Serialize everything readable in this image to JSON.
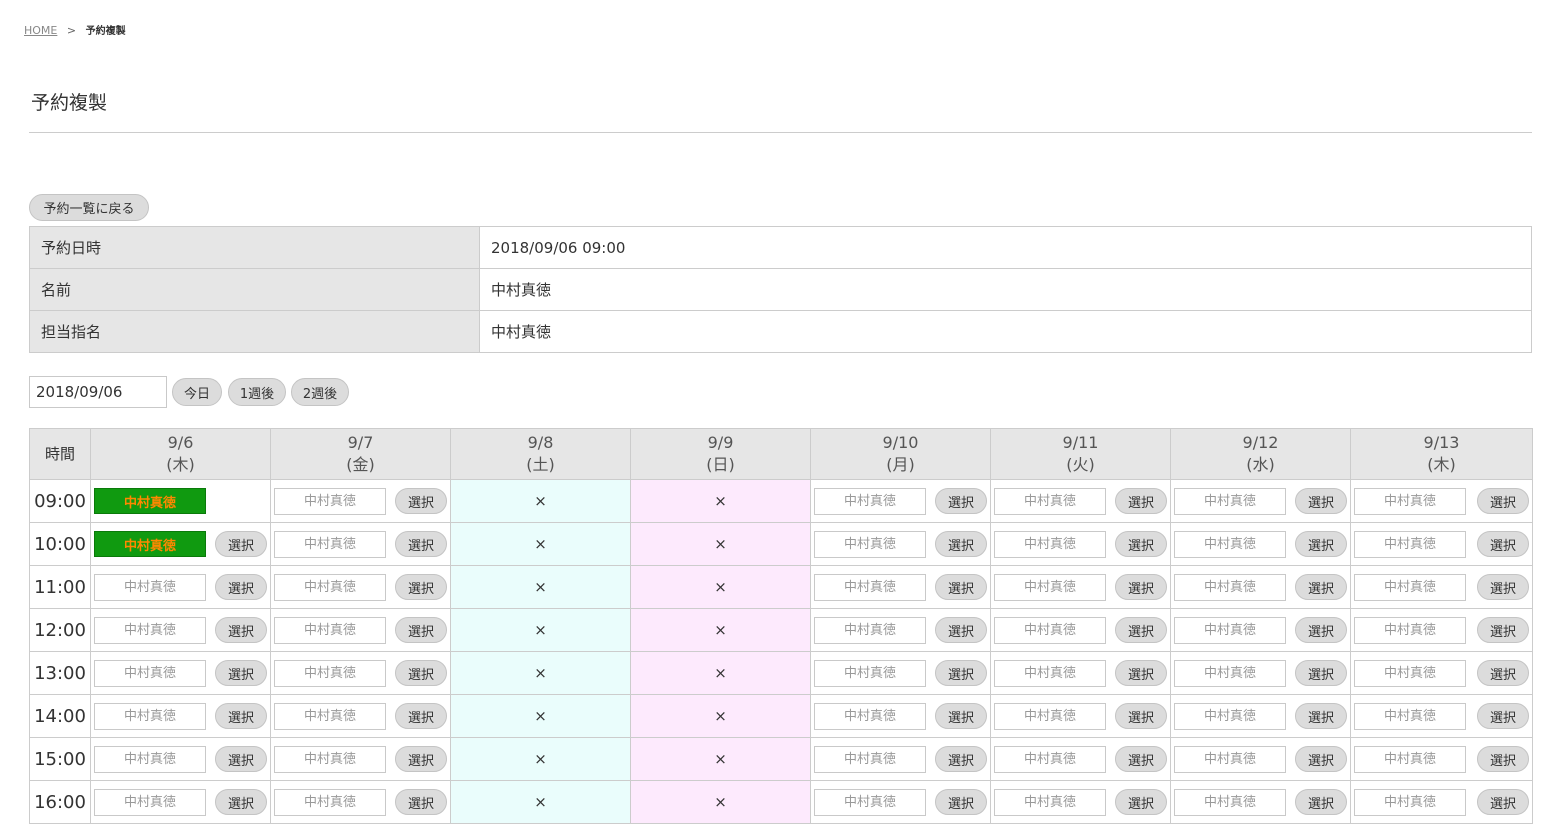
{
  "breadcrumb": {
    "home": "HOME",
    "separator": ">",
    "current": "予約複製"
  },
  "page_title": "予約複製",
  "back_button": "予約一覧に戻る",
  "info": [
    {
      "label": "予約日時",
      "value": "2018/09/06 09:00"
    },
    {
      "label": "名前",
      "value": "中村真徳"
    },
    {
      "label": "担当指名",
      "value": "中村真徳"
    }
  ],
  "date_field": {
    "value": "2018/09/06"
  },
  "nav": {
    "today": "今日",
    "one_week": "1週後",
    "two_weeks": "2週後"
  },
  "schedule": {
    "time_header": "時間",
    "days": [
      {
        "date": "9/6",
        "weekday": "(木)",
        "type": "weekday"
      },
      {
        "date": "9/7",
        "weekday": "(金)",
        "type": "weekday"
      },
      {
        "date": "9/8",
        "weekday": "(土)",
        "type": "closed-sat"
      },
      {
        "date": "9/9",
        "weekday": "(日)",
        "type": "closed-sun"
      },
      {
        "date": "9/10",
        "weekday": "(月)",
        "type": "weekday"
      },
      {
        "date": "9/11",
        "weekday": "(火)",
        "type": "weekday"
      },
      {
        "date": "9/12",
        "weekday": "(水)",
        "type": "weekday"
      },
      {
        "date": "9/13",
        "weekday": "(木)",
        "type": "weekday"
      }
    ],
    "times": [
      "09:00",
      "10:00",
      "11:00",
      "12:00",
      "13:00",
      "14:00",
      "15:00",
      "16:00"
    ],
    "slot_placeholder": "中村真徳",
    "select_label": "選択",
    "closed_mark": "×",
    "booked_label": "中村真徳",
    "booked": [
      {
        "time": "09:00",
        "date": "9/6",
        "select_button": false
      },
      {
        "time": "10:00",
        "date": "9/6",
        "select_button": true
      }
    ],
    "colors": {
      "booked_bg": "#109a10",
      "booked_text": "#ff8800",
      "saturday_bg": "#eafdfc",
      "sunday_bg": "#fdeafd",
      "header_bg": "#e6e6e6"
    }
  }
}
